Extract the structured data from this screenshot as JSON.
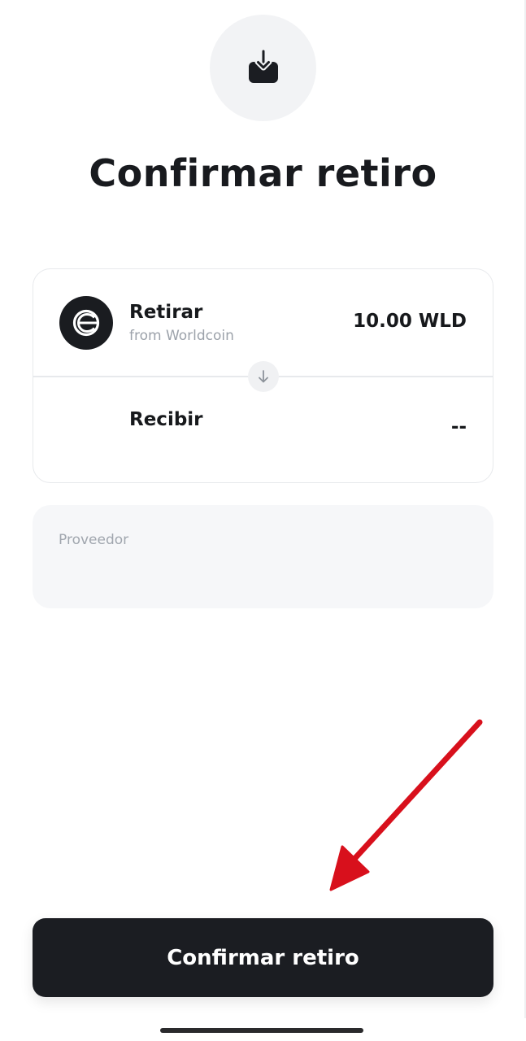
{
  "header": {
    "icon": "withdraw-tray-icon",
    "title": "Confirmar retiro"
  },
  "withdraw_card": {
    "source": {
      "icon": "worldcoin-logo-icon",
      "label": "Retirar",
      "subtitle": "from Worldcoin",
      "amount": "10.00 WLD"
    },
    "swap_icon": "arrow-down-icon",
    "destination": {
      "label": "Recibir",
      "amount": "--"
    }
  },
  "provider": {
    "label": "Proveedor"
  },
  "annotation": {
    "color": "#d8101c",
    "icon": "red-arrow-annotation"
  },
  "footer": {
    "confirm_label": "Confirmar retiro"
  },
  "colors": {
    "button_bg": "#1b1d22",
    "button_text": "#ffffff",
    "muted_text": "#9ca2aa"
  }
}
